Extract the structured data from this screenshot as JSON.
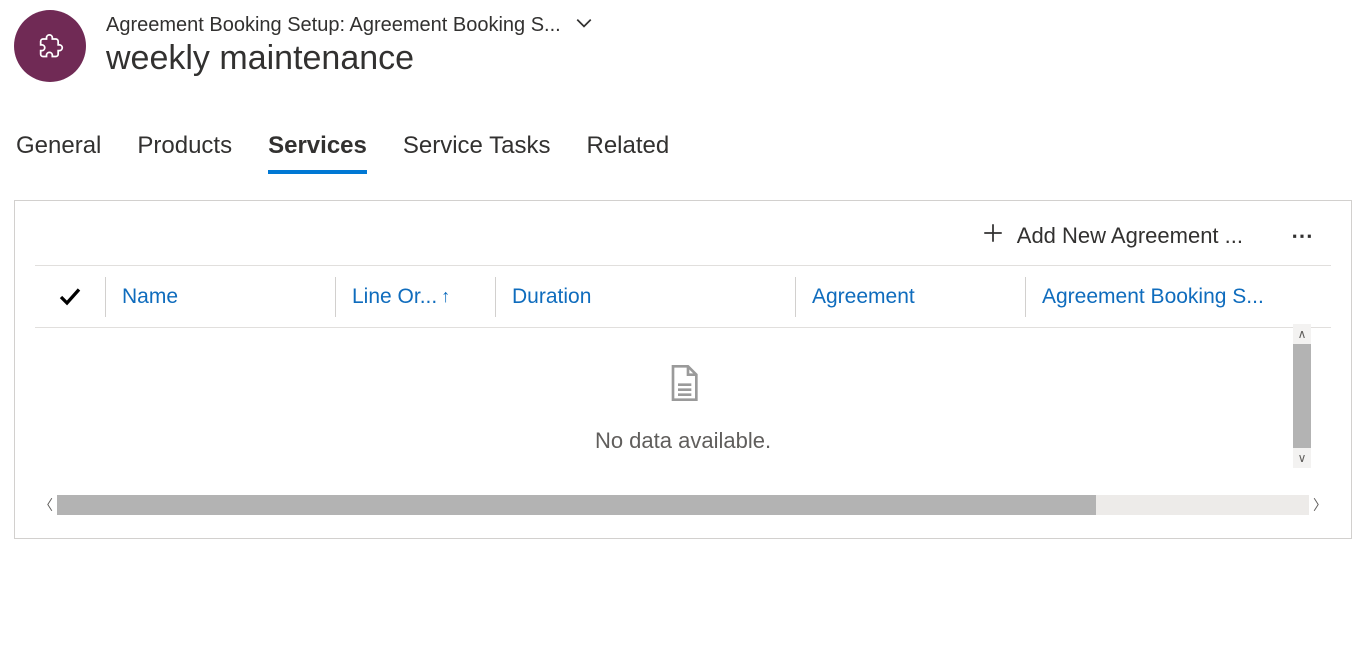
{
  "header": {
    "breadcrumb": "Agreement Booking Setup: Agreement Booking S...",
    "title": "weekly maintenance"
  },
  "tabs": {
    "general": "General",
    "products": "Products",
    "services": "Services",
    "service_tasks": "Service Tasks",
    "related": "Related",
    "active": "services"
  },
  "panel": {
    "add_label": "Add New Agreement ...",
    "columns": {
      "name": "Name",
      "line_order": "Line Or...",
      "duration": "Duration",
      "agreement": "Agreement",
      "booking_setup": "Agreement Booking S..."
    },
    "sort_column": "line_order",
    "sort_dir": "asc",
    "empty_text": "No data available."
  },
  "colors": {
    "accent": "#0078d4",
    "link": "#0f6cbd",
    "entity_bg": "#702a55"
  }
}
